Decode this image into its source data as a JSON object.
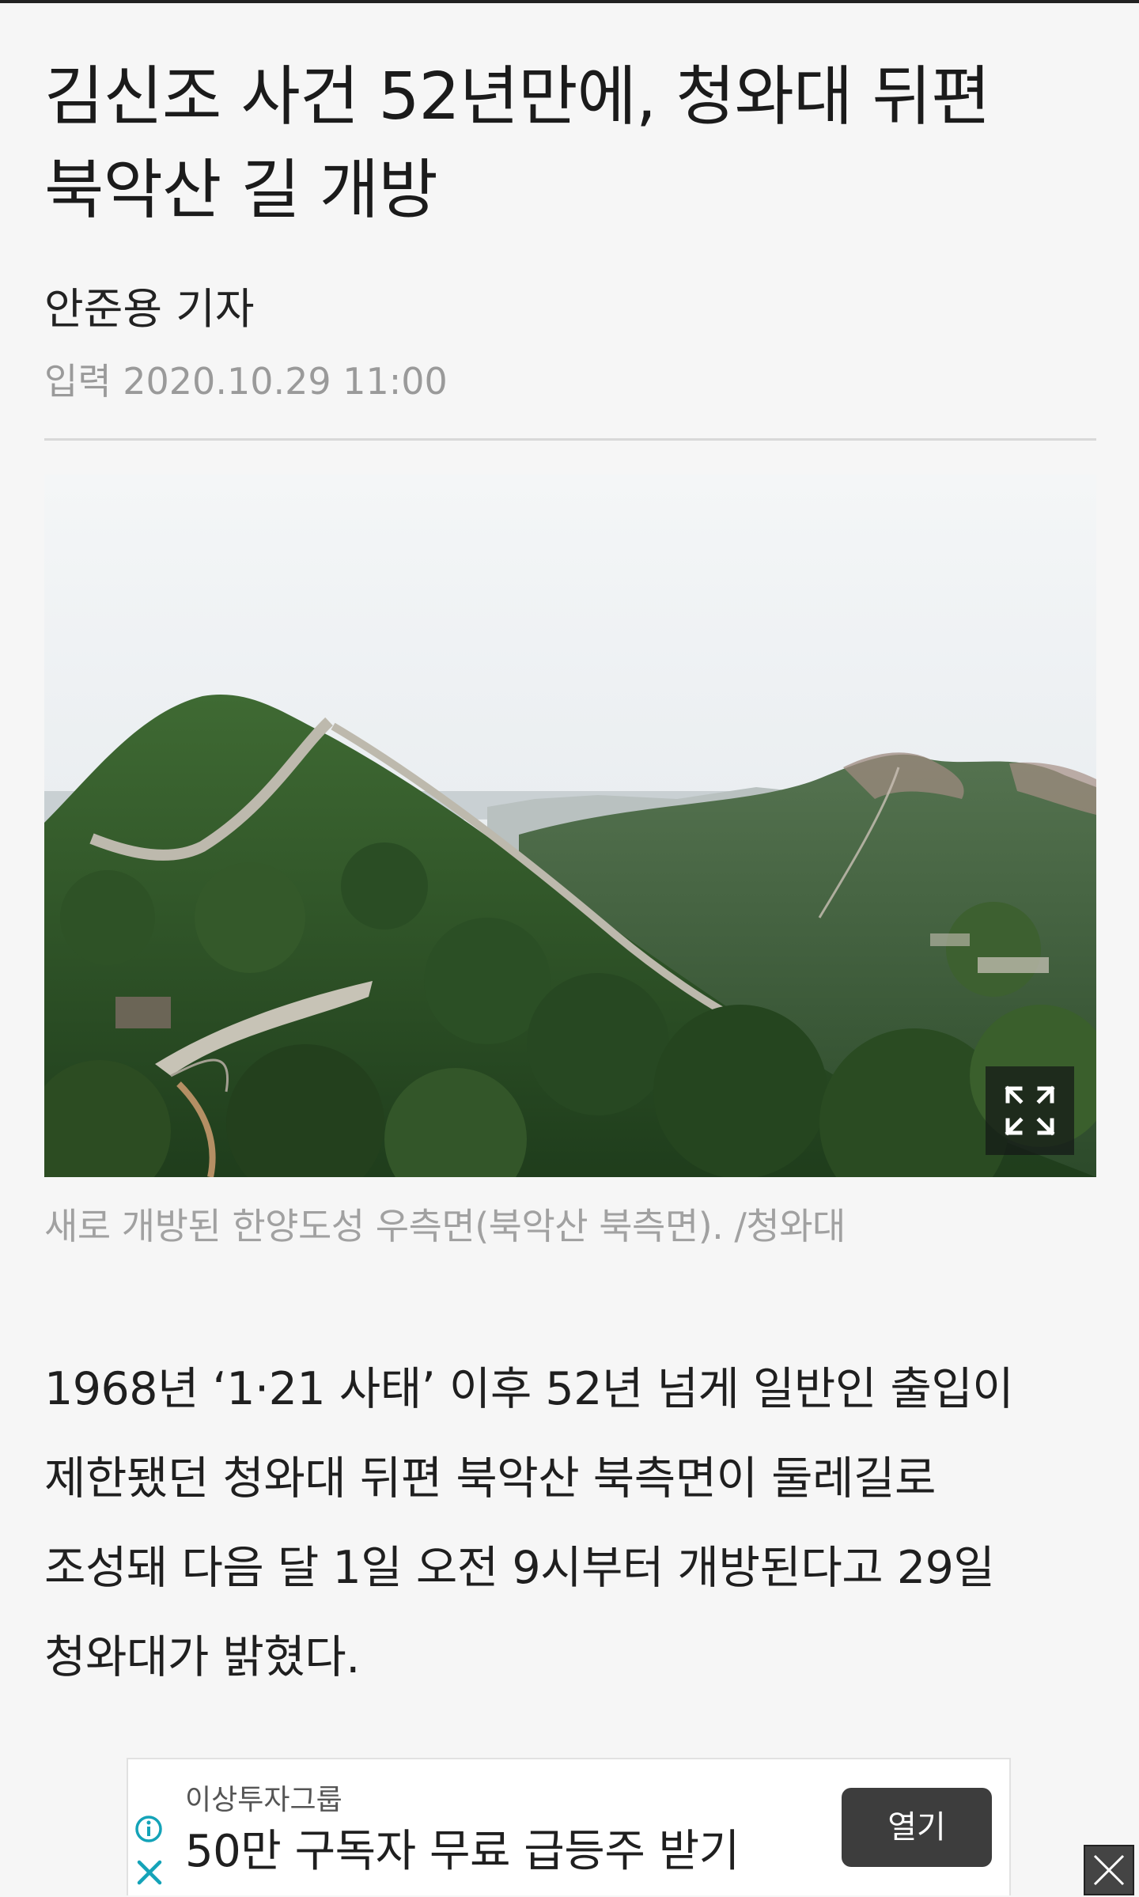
{
  "article": {
    "headline_line1": "김신조 사건 52년만에, 청와대 뒤편",
    "headline_line2": "북악산 길 개방",
    "byline": "안준용 기자",
    "published": "입력 2020.10.29 11:00",
    "photo_caption": "새로 개방된 한양도성 우측면(북악산 북측면). /청와대",
    "body_line1": "1968년 ‘1·21 사태’ 이후 52년 넘게 일반인 출입이",
    "body_line2": "제한됐던 청와대 뒤편 북악산 북측면이 둘레길로",
    "body_line3": "조성돼 다음 달 1일 오전 9시부터 개방된다고 29일",
    "body_line4": "청와대가 밝혔다."
  },
  "ad": {
    "sponsor": "이상투자그룹",
    "headline": "50만 구독자 무료 급등주 받기",
    "cta_label": "열기",
    "info_icon": "info-icon",
    "close_icon": "close-icon"
  },
  "icons": {
    "expand": "expand-icon",
    "corner_close": "close-icon"
  },
  "colors": {
    "background": "#f6f6f6",
    "meta_gray": "#9a9a9a",
    "ad_accent": "#14a3b8",
    "cta_bg": "#3d3d3d"
  }
}
